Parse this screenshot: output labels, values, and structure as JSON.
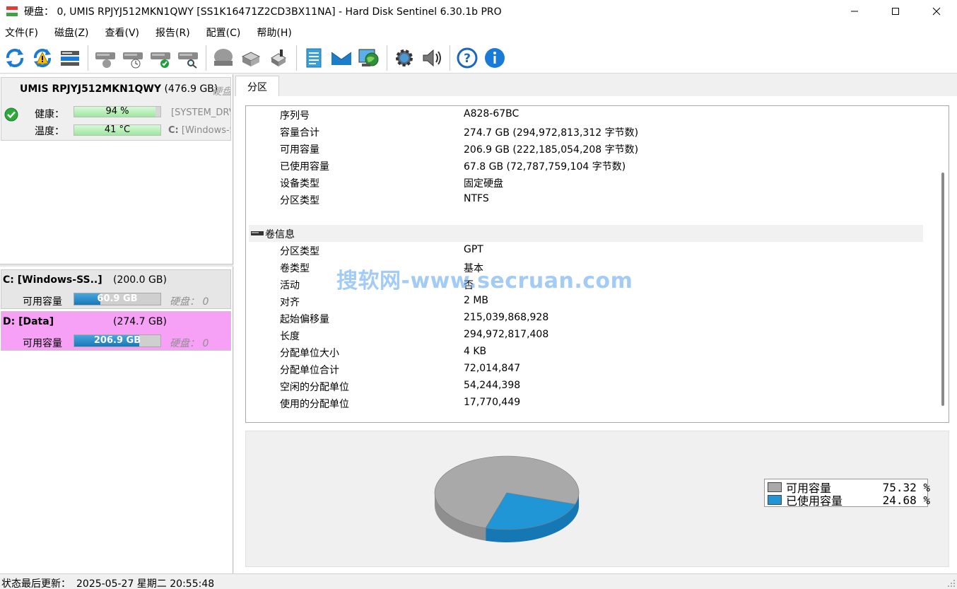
{
  "window": {
    "title": "硬盘： 0, UMIS RPJYJ512MKN1QWY [SS1K16471Z2CD3BX11NA]  -  Hard Disk Sentinel 6.30.1b PRO"
  },
  "menu": [
    "文件(F)",
    "磁盘(Z)",
    "查看(V)",
    "报告(R)",
    "配置(C)",
    "帮助(H)"
  ],
  "toolbar": {
    "icons": [
      "refresh-icon",
      "refresh-warning-icon",
      "disk-list-icon",
      "disk-performance-icon",
      "disk-schedule-icon",
      "disk-check-icon",
      "disk-search-icon",
      "hdd-gray-icon",
      "hdd-arrow-icon",
      "hdd-tools-icon",
      "report-icon",
      "email-icon",
      "network-globe-icon",
      "settings-gear-icon",
      "sound-icon",
      "help-icon",
      "info-icon"
    ]
  },
  "disk": {
    "name": "UMIS RPJYJ512MKN1QWY",
    "size": "(476.9 GB)",
    "kind": "硬盘",
    "health_label": "健康：",
    "health_value": "94 %",
    "health_pct": 94,
    "temp_label": "温度：",
    "temp_value": "41 °C",
    "temp_pct": 100,
    "right_text_1": "[SYSTEM_DRV",
    "right_text_2_bold": "C:",
    "right_text_2": " [Windows-S"
  },
  "partitions": [
    {
      "name": "C: [Windows-SS..]",
      "size": "(200.0 GB)",
      "free_label": "可用容量",
      "free_value": "60.9 GB",
      "free_pct": 30,
      "disk_label": "硬盘：  0",
      "bg": "#e6e6e6"
    },
    {
      "name": "D: [Data]",
      "size": "(274.7 GB)",
      "free_label": "可用容量",
      "free_value": "206.9 GB",
      "free_pct": 75,
      "disk_label": "硬盘：  0",
      "bg": "#f6a0f6"
    }
  ],
  "tab": "分区",
  "details": [
    {
      "k": "序列号",
      "v": "A828-67BC"
    },
    {
      "k": "容量合计",
      "v": "274.7 GB (294,972,813,312 字节数)"
    },
    {
      "k": "可用容量",
      "v": "206.9 GB (222,185,054,208 字节数)"
    },
    {
      "k": "已使用容量",
      "v": "67.8 GB (72,787,759,104 字节数)"
    },
    {
      "k": "设备类型",
      "v": "固定硬盘"
    },
    {
      "k": "分区类型",
      "v": "NTFS"
    }
  ],
  "volume_section": "卷信息",
  "volume": [
    {
      "k": "分区类型",
      "v": "GPT"
    },
    {
      "k": "卷类型",
      "v": "基本"
    },
    {
      "k": "活动",
      "v": "否"
    },
    {
      "k": "对齐",
      "v": "2 MB"
    },
    {
      "k": "起始偏移量",
      "v": "215,039,868,928"
    },
    {
      "k": "长度",
      "v": "294,972,817,408"
    },
    {
      "k": "分配单位大小",
      "v": "4 KB"
    },
    {
      "k": "分配单位合计",
      "v": "72,014,847"
    },
    {
      "k": "空闲的分配单位",
      "v": "54,244,398"
    },
    {
      "k": "使用的分配单位",
      "v": "17,770,449"
    }
  ],
  "chart_data": {
    "type": "pie",
    "categories": [
      "可用容量",
      "已使用容量"
    ],
    "values": [
      75.32,
      24.68
    ],
    "labels": [
      "75.32 %",
      "24.68 %"
    ],
    "colors": [
      "#a9a9a9",
      "#2196d6"
    ],
    "legend": "right"
  },
  "watermark": "搜软网-www.secruan.com",
  "status": {
    "label": "状态最后更新：",
    "value": "2025-05-27 星期二 20:55:48"
  }
}
